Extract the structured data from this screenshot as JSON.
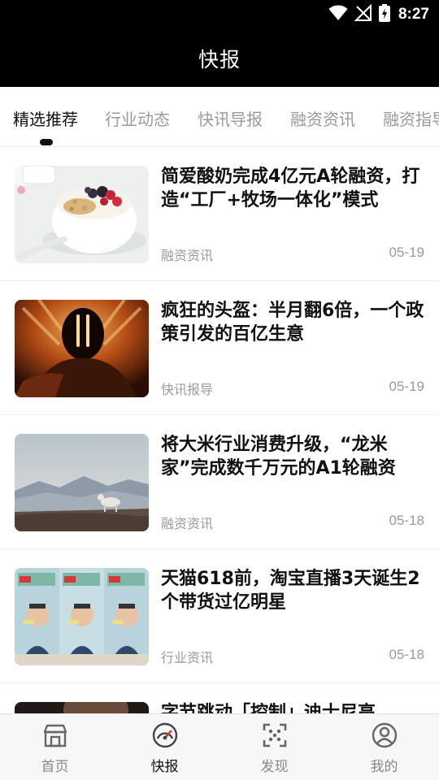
{
  "status_bar": {
    "time": "8:27"
  },
  "header": {
    "title": "快报"
  },
  "tabs": [
    {
      "label": "精选推荐",
      "active": true
    },
    {
      "label": "行业动态",
      "active": false
    },
    {
      "label": "快讯导报",
      "active": false
    },
    {
      "label": "融资资讯",
      "active": false
    },
    {
      "label": "融资指导",
      "active": false
    }
  ],
  "feed": {
    "items": [
      {
        "title": "简爱酸奶完成4亿元A轮融资，打造“工厂+牧场一体化”模式",
        "category": "融资资讯",
        "date": "05-19",
        "image": "yogurt-bowl-image"
      },
      {
        "title": "疯狂的头盔：半月翻6倍，一个政策引发的百亿生意",
        "category": "快讯报导",
        "date": "05-19",
        "image": "helmet-image"
      },
      {
        "title": "将大米行业消费升级，“龙米家”完成数千万元的A1轮融资",
        "category": "融资资讯",
        "date": "05-18",
        "image": "mountain-dog-image"
      },
      {
        "title": "天猫618前，淘宝直播3天诞生2个带货过亿明星",
        "category": "行业资讯",
        "date": "05-18",
        "image": "livestream-image"
      },
      {
        "title": "字节跳动「控制」迪士尼高",
        "category": "",
        "date": "",
        "image": "portrait-image"
      }
    ]
  },
  "bottom_nav": {
    "items": [
      {
        "label": "首页",
        "icon": "store-icon",
        "active": false
      },
      {
        "label": "快报",
        "icon": "gauge-icon",
        "active": true
      },
      {
        "label": "发现",
        "icon": "scan-icon",
        "active": false
      },
      {
        "label": "我的",
        "icon": "user-icon",
        "active": false
      }
    ]
  },
  "colors": {
    "header_bg": "#000000",
    "active_text": "#111111",
    "inactive_text": "#999999"
  }
}
